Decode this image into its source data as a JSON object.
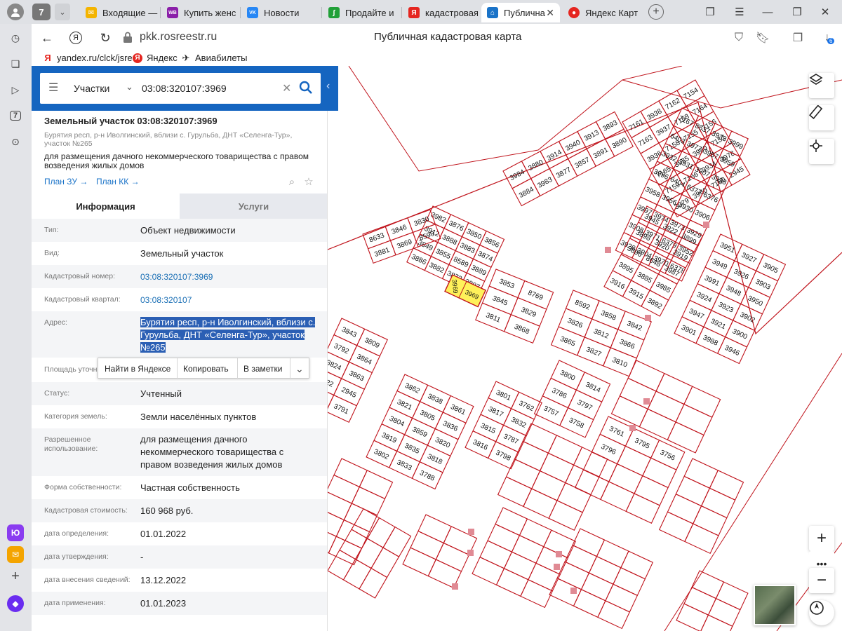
{
  "browser": {
    "tab_count": "7",
    "tabs": [
      {
        "title": "Входящие —",
        "icon": "mail-icon",
        "color": "#f4b400",
        "glyph": "✉"
      },
      {
        "title": "Купить женс",
        "icon": "wildberries-icon",
        "color": "#8b1fa9",
        "glyph": "WB"
      },
      {
        "title": "Новости",
        "icon": "vk-icon",
        "color": "#2787f5",
        "glyph": "VK"
      },
      {
        "title": "Продайте и",
        "icon": "market-icon",
        "color": "#21a038",
        "glyph": "∫"
      },
      {
        "title": "кадастровая",
        "icon": "yandex-icon",
        "color": "#e52620",
        "glyph": "Я"
      },
      {
        "title": "Публична",
        "icon": "rosreestr-icon",
        "color": "#1a73c8",
        "glyph": "⌂"
      },
      {
        "title": "Яндекс Карт",
        "icon": "yandex-maps-icon",
        "color": "#e52620",
        "glyph": "●"
      }
    ],
    "url": "pkk.rosreestr.ru",
    "page_title": "Публичная кадастровая карта",
    "downloads_badge": "6",
    "bookmarks": [
      "yandex.ru/clck/jsre",
      "Яндекс",
      "Авиабилеты"
    ]
  },
  "search": {
    "type_label": "Участки",
    "query": "03:08:320107:3969"
  },
  "object": {
    "title": "Земельный участок 03:08:320107:3969",
    "address": "Бурятия респ, р-н Иволгинский, вблизи с. Гурульба, ДНТ «Селенга-Тур», участок №265",
    "purpose": "для размещения дачного некоммерческого товарищества с правом возведения жилых домов",
    "plan_zu": "План ЗУ →",
    "plan_kk": "План КК →"
  },
  "tabs": {
    "info": "Информация",
    "services": "Услуги"
  },
  "rows": [
    {
      "label": "Тип:",
      "value": "Объект недвижимости"
    },
    {
      "label": "Вид:",
      "value": "Земельный участок"
    },
    {
      "label": "Кадастровый номер:",
      "value": "03:08:320107:3969"
    },
    {
      "label": "Кадастровый квартал:",
      "value": "03:08:320107"
    },
    {
      "label": "Адрес:",
      "value": "Бурятия респ, р-н Иволгинский, вблизи с. Гурульба, ДНТ «Селенга-Тур», участок №265"
    },
    {
      "label": "Площадь уточн",
      "value": ""
    },
    {
      "label": "Статус:",
      "value": "Учтенный"
    },
    {
      "label": "Категория земель:",
      "value": "Земли населённых пунктов"
    },
    {
      "label": "Разрешенное использование:",
      "value": "для размещения дачного некоммерческого товарищества с правом возведения жилых домов"
    },
    {
      "label": "Форма собственности:",
      "value": "Частная собственность"
    },
    {
      "label": "Кадастровая стоимость:",
      "value": "160 968 руб."
    },
    {
      "label": "дата определения:",
      "value": "01.01.2022"
    },
    {
      "label": "дата утверждения:",
      "value": "-"
    },
    {
      "label": "дата внесения сведений:",
      "value": "13.12.2022"
    },
    {
      "label": "дата применения:",
      "value": "01.01.2023"
    }
  ],
  "context_menu": {
    "find": "Найти в Яндексе",
    "copy": "Копировать",
    "notes": "В заметки"
  },
  "map": {
    "parcel_color": "#c0141c",
    "selected_fill": "#fff15a",
    "selected_label": "3969",
    "labels": [
      "7161",
      "3938",
      "7162",
      "7154",
      "7163",
      "3937",
      "7168",
      "7164",
      "3936",
      "7158",
      "7155",
      "7156",
      "7165",
      "3935",
      "3980",
      "7157",
      "7159",
      "7166",
      "3934",
      "3978",
      "3979",
      "3960",
      "7160",
      "2945",
      "7167",
      "8637",
      "3933",
      "3999",
      "6403",
      "3977",
      "3957",
      "3959",
      "3932",
      "3931",
      "3907",
      "3998",
      "3996",
      "6404",
      "6377",
      "6376",
      "3958",
      "3956",
      "3930",
      "3906",
      "3997",
      "3974",
      "3973",
      "3929",
      "3908",
      "3971",
      "6379",
      "3952",
      "3928",
      "3904",
      "3970",
      "6378",
      "3951",
      "3927",
      "3905",
      "3949",
      "3926",
      "3903",
      "3991",
      "3948",
      "3950",
      "3924",
      "3923",
      "3902",
      "3947",
      "3921",
      "3900",
      "3901",
      "3988",
      "3946",
      "3945",
      "3922",
      "3899",
      "3898",
      "3920",
      "3919",
      "3896",
      "8648",
      "3987",
      "3895",
      "3885",
      "3985",
      "3916",
      "3915",
      "3892",
      "3984",
      "3880",
      "3914",
      "3940",
      "3913",
      "3893",
      "3884",
      "3983",
      "3877",
      "3857",
      "3891",
      "3890",
      "3982",
      "3876",
      "3850",
      "3856",
      "3912",
      "3888",
      "3883",
      "3874",
      "3849",
      "3855",
      "8589",
      "3889",
      "3886",
      "3882",
      "3873",
      "3887",
      "8633",
      "3846",
      "3830",
      "3881",
      "3869",
      "8590",
      "3853",
      "8769",
      "3845",
      "3829",
      "3811",
      "3868",
      "8592",
      "3858",
      "3842",
      "3826",
      "3812",
      "3866",
      "3865",
      "3827",
      "3810",
      "3843",
      "3809",
      "3792",
      "3864",
      "3824",
      "3863",
      "3822",
      "2945",
      "3808",
      "3791",
      "3862",
      "3838",
      "3861",
      "3821",
      "3805",
      "3836",
      "3804",
      "3859",
      "3820",
      "3819",
      "3835",
      "3818",
      "3802",
      "3833",
      "3788",
      "3801",
      "3762",
      "3817",
      "3832",
      "3815",
      "3787",
      "3816",
      "3798",
      "3800",
      "3814",
      "3786",
      "3797",
      "3757",
      "3758",
      "3761",
      "3795",
      "3756",
      "3796"
    ]
  }
}
